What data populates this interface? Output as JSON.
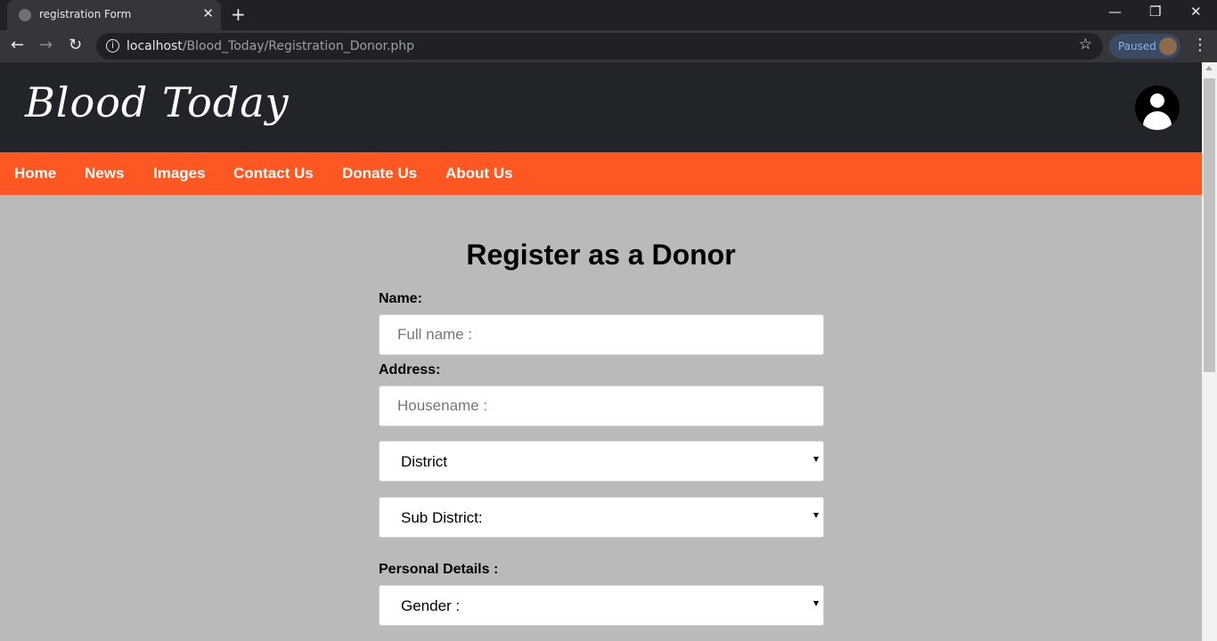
{
  "browser": {
    "tab_title": "registration Form",
    "url_host": "localhost",
    "url_path": "/Blood_Today/Registration_Donor.php",
    "profile_status": "Paused"
  },
  "header": {
    "logo": "Blood Today"
  },
  "nav": {
    "items": [
      "Home",
      "News",
      "Images",
      "Contact Us",
      "Donate Us",
      "About Us"
    ]
  },
  "form": {
    "title": "Register as a Donor",
    "name_label": "Name:",
    "name_placeholder": "Full name :",
    "address_label": "Address:",
    "housename_placeholder": "Housename :",
    "district_value": "District",
    "subdistrict_value": "Sub District:",
    "personal_label": "Personal Details :",
    "gender_value": "Gender :"
  },
  "colors": {
    "header_bg": "#212529",
    "nav_bg": "#ff5722",
    "page_bg": "#bababa"
  }
}
